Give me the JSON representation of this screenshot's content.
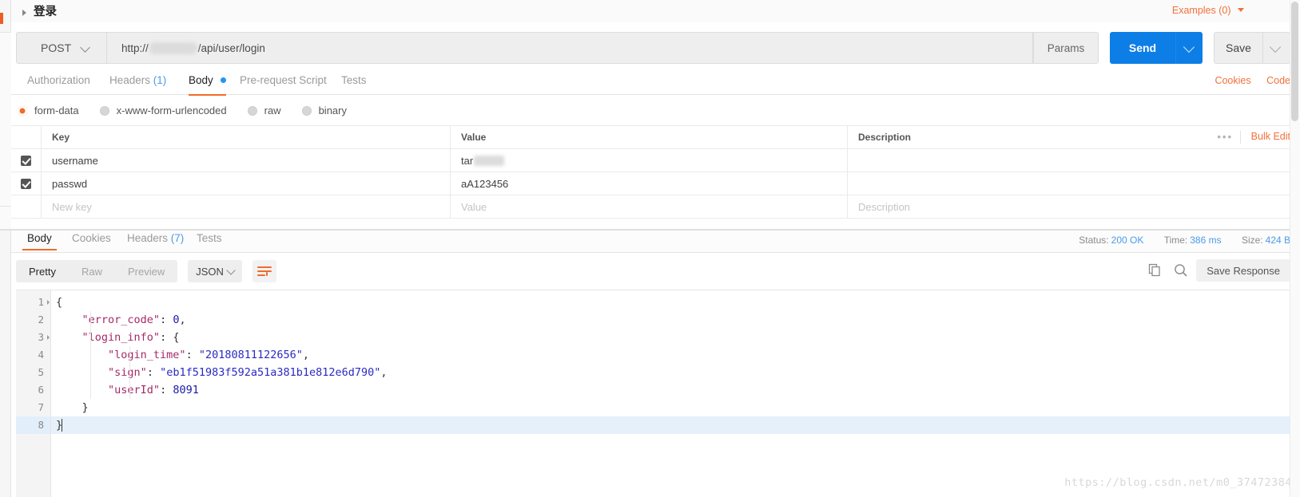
{
  "request": {
    "title": "登录",
    "examples_label": "Examples (0)",
    "method": "POST",
    "url_prefix": "http://",
    "url_suffix": "/api/user/login",
    "params_label": "Params",
    "send_label": "Send",
    "save_label": "Save",
    "tabs": [
      {
        "label": "Authorization",
        "active": false
      },
      {
        "label": "Headers",
        "count": "(1)",
        "active": false
      },
      {
        "label": "Body",
        "active": true,
        "dot": true
      },
      {
        "label": "Pre-request Script",
        "active": false
      },
      {
        "label": "Tests",
        "active": false
      }
    ],
    "cookies_label": "Cookies",
    "code_label": "Code",
    "body_types": [
      {
        "label": "form-data",
        "checked": true
      },
      {
        "label": "x-www-form-urlencoded",
        "checked": false
      },
      {
        "label": "raw",
        "checked": false
      },
      {
        "label": "binary",
        "checked": false
      }
    ],
    "table": {
      "headers": {
        "key": "Key",
        "value": "Value",
        "description": "Description"
      },
      "bulk_edit_label": "Bulk Edit",
      "rows": [
        {
          "checked": true,
          "key": "username",
          "value": "tar",
          "value_masked": true,
          "description": ""
        },
        {
          "checked": true,
          "key": "passwd",
          "value": "aA123456",
          "value_masked": false,
          "description": ""
        }
      ],
      "placeholder_row": {
        "key": "New key",
        "value": "Value",
        "description": "Description"
      }
    }
  },
  "response": {
    "tabs": [
      {
        "label": "Body",
        "active": true
      },
      {
        "label": "Cookies",
        "active": false
      },
      {
        "label": "Headers",
        "count": "(7)",
        "active": false
      },
      {
        "label": "Tests",
        "active": false
      }
    ],
    "meta": {
      "status_label": "Status:",
      "status_value": "200 OK",
      "time_label": "Time:",
      "time_value": "386 ms",
      "size_label": "Size:",
      "size_value": "424 B"
    },
    "view_modes": [
      {
        "label": "Pretty",
        "active": true
      },
      {
        "label": "Raw",
        "active": false
      },
      {
        "label": "Preview",
        "active": false
      }
    ],
    "format": "JSON",
    "save_response_label": "Save Response",
    "body_lines": [
      {
        "n": "1",
        "fold": true,
        "html": "<span class=\"tok-punc\">{</span>"
      },
      {
        "n": "2",
        "fold": false,
        "html": "    <span class=\"tok-key\">\"error_code\"</span><span class=\"tok-punc\">: </span><span class=\"tok-num\">0</span><span class=\"tok-punc\">,</span>"
      },
      {
        "n": "3",
        "fold": true,
        "html": "    <span class=\"tok-key\">\"login_info\"</span><span class=\"tok-punc\">: {</span>"
      },
      {
        "n": "4",
        "fold": false,
        "html": "        <span class=\"tok-key\">\"login_time\"</span><span class=\"tok-punc\">: </span><span class=\"tok-str\">\"20180811122656\"</span><span class=\"tok-punc\">,</span>"
      },
      {
        "n": "5",
        "fold": false,
        "html": "        <span class=\"tok-key\">\"sign\"</span><span class=\"tok-punc\">: </span><span class=\"tok-str\">\"eb1f51983f592a51a381b1e812e6d790\"</span><span class=\"tok-punc\">,</span>"
      },
      {
        "n": "6",
        "fold": false,
        "html": "        <span class=\"tok-key\">\"userId\"</span><span class=\"tok-punc\">: </span><span class=\"tok-num\">8091</span>"
      },
      {
        "n": "7",
        "fold": false,
        "html": "    <span class=\"tok-punc\">}</span>"
      },
      {
        "n": "8",
        "fold": false,
        "highlight": true,
        "html": "<span class=\"tok-punc\">}</span>"
      }
    ],
    "json_values": {
      "error_code": 0,
      "login_info": {
        "login_time": "20180811122656",
        "sign": "eb1f51983f592a51a381b1e812e6d790",
        "userId": 8091
      }
    }
  },
  "watermark": "https://blog.csdn.net/m0_37472384",
  "colors": {
    "accent": "#ef6c2b",
    "send": "#0d7ee6",
    "link": "#4c9aeb"
  }
}
